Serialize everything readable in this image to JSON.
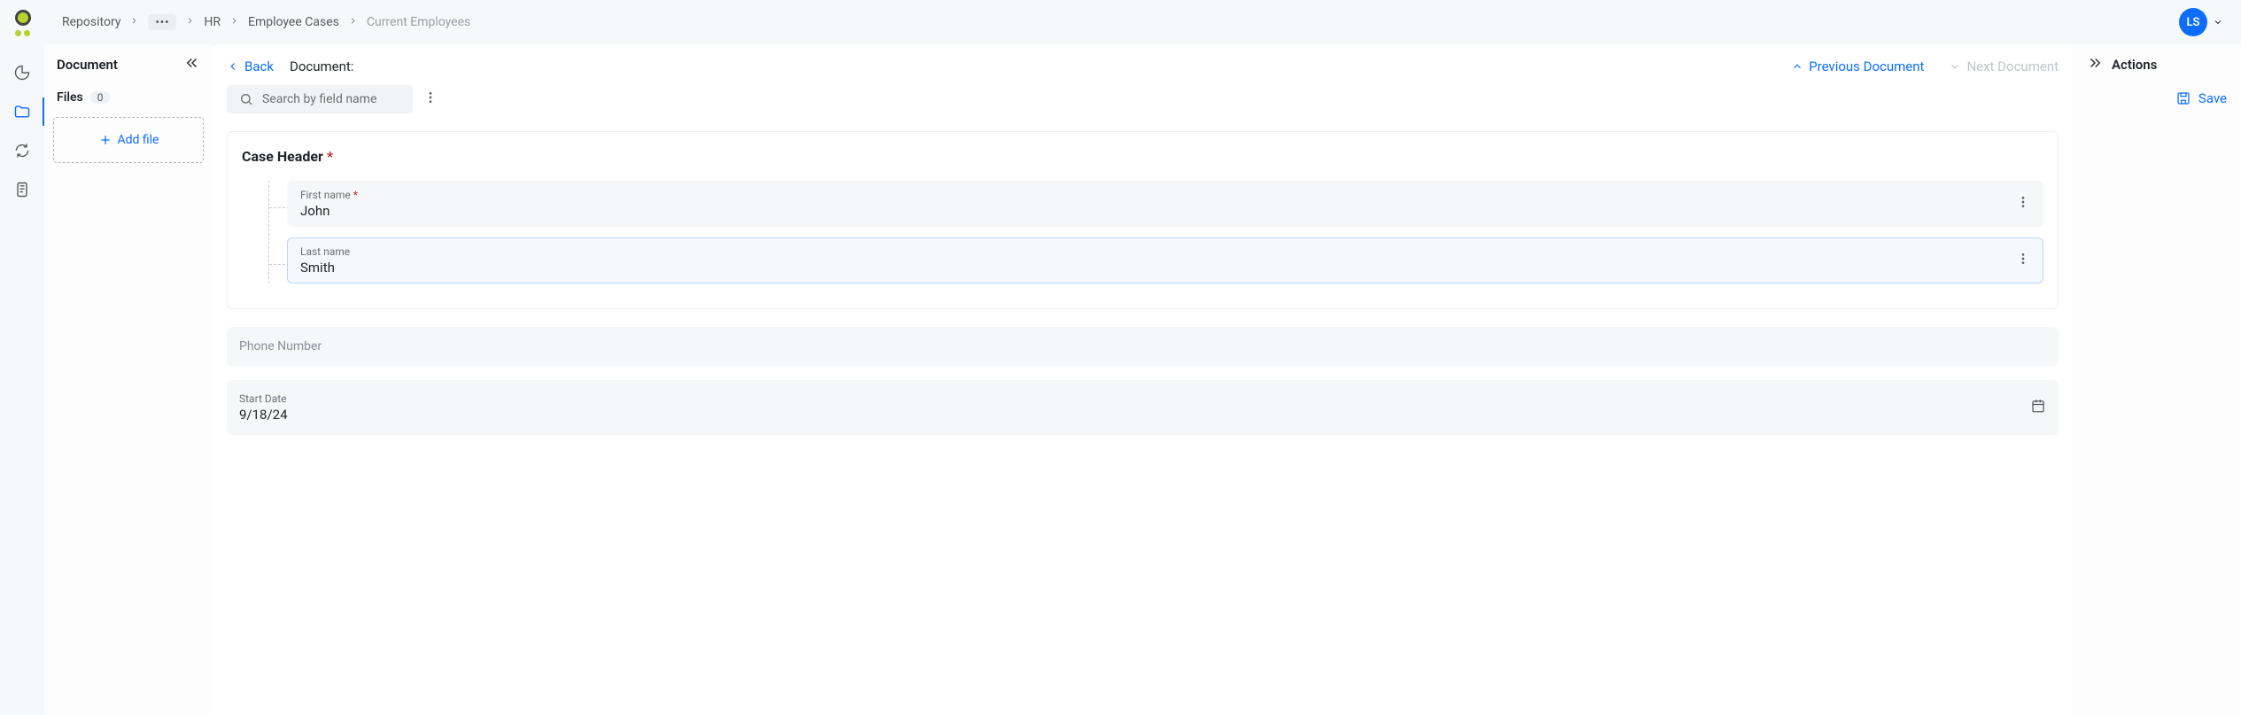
{
  "breadcrumb": {
    "root": "Repository",
    "seg1": "HR",
    "seg2": "Employee Cases",
    "current": "Current Employees"
  },
  "user": {
    "initials": "LS"
  },
  "sidebar": {
    "title": "Document",
    "files_label": "Files",
    "files_count": "0",
    "add_file_label": "Add file"
  },
  "main": {
    "back_label": "Back",
    "doc_prefix": "Document:",
    "prev_doc_label": "Previous Document",
    "next_doc_label": "Next Document",
    "search_placeholder": "Search by field name"
  },
  "form": {
    "section_title": "Case Header",
    "first_name": {
      "label": "First name",
      "value": "John"
    },
    "last_name": {
      "label": "Last name",
      "value": "Smith"
    },
    "phone": {
      "label": "Phone Number",
      "value": ""
    },
    "start_date": {
      "label": "Start Date",
      "value": "9/18/24"
    }
  },
  "actions": {
    "title": "Actions",
    "save_label": "Save"
  }
}
